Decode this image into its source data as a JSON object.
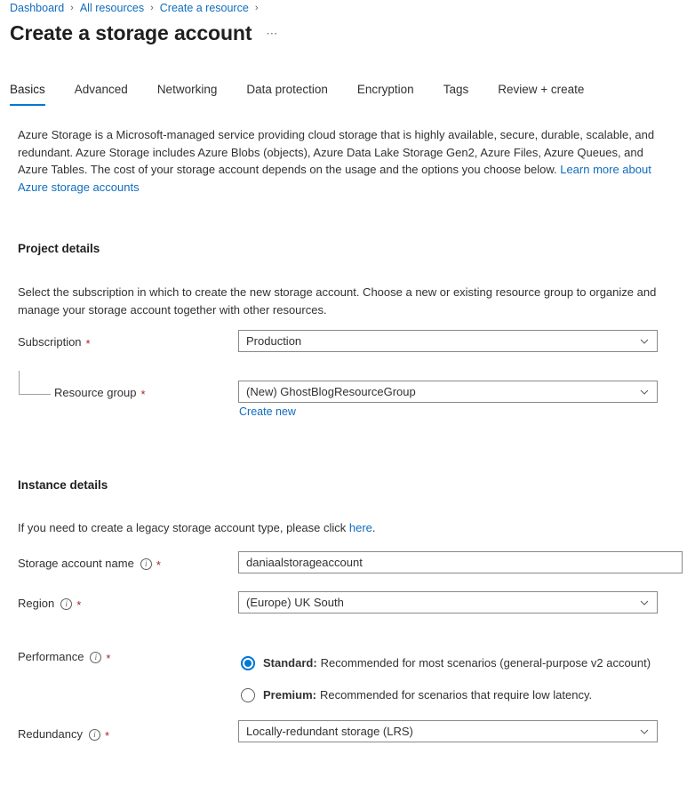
{
  "breadcrumb": {
    "items": [
      {
        "label": "Dashboard"
      },
      {
        "label": "All resources"
      },
      {
        "label": "Create a resource"
      }
    ],
    "separator": "›"
  },
  "header": {
    "title": "Create a storage account",
    "ellipsis": "⋯"
  },
  "tabs": [
    {
      "label": "Basics",
      "active": true
    },
    {
      "label": "Advanced",
      "active": false
    },
    {
      "label": "Networking",
      "active": false
    },
    {
      "label": "Data protection",
      "active": false
    },
    {
      "label": "Encryption",
      "active": false
    },
    {
      "label": "Tags",
      "active": false
    },
    {
      "label": "Review + create",
      "active": false
    }
  ],
  "intro": {
    "text": "Azure Storage is a Microsoft-managed service providing cloud storage that is highly available, secure, durable, scalable, and redundant. Azure Storage includes Azure Blobs (objects), Azure Data Lake Storage Gen2, Azure Files, Azure Queues, and Azure Tables. The cost of your storage account depends on the usage and the options you choose below. ",
    "link_text": "Learn more about Azure storage accounts"
  },
  "project_details": {
    "heading": "Project details",
    "description": "Select the subscription in which to create the new storage account. Choose a new or existing resource group to organize and manage your storage account together with other resources.",
    "subscription": {
      "label": "Subscription",
      "required": "*",
      "value": "Production"
    },
    "resource_group": {
      "label": "Resource group",
      "required": "*",
      "value": "(New) GhostBlogResourceGroup",
      "create_new_label": "Create new"
    }
  },
  "instance_details": {
    "heading": "Instance details",
    "legacy_note_prefix": "If you need to create a legacy storage account type, please click ",
    "legacy_note_link": "here",
    "legacy_note_suffix": ".",
    "storage_account_name": {
      "label": "Storage account name",
      "required": "*",
      "value": "daniaalstorageaccount",
      "placeholder": ""
    },
    "region": {
      "label": "Region",
      "required": "*",
      "value": "(Europe) UK South"
    },
    "performance": {
      "label": "Performance",
      "required": "*",
      "options": [
        {
          "strong": "Standard:",
          "text": " Recommended for most scenarios (general-purpose v2 account)",
          "selected": true
        },
        {
          "strong": "Premium:",
          "text": " Recommended for scenarios that require low latency.",
          "selected": false
        }
      ]
    },
    "redundancy": {
      "label": "Redundancy",
      "required": "*",
      "value": "Locally-redundant storage (LRS)"
    }
  },
  "colors": {
    "accent": "#0078d4",
    "link": "#0f6cbd",
    "required": "#a4262c",
    "border": "#8a8886",
    "text": "#323130"
  }
}
